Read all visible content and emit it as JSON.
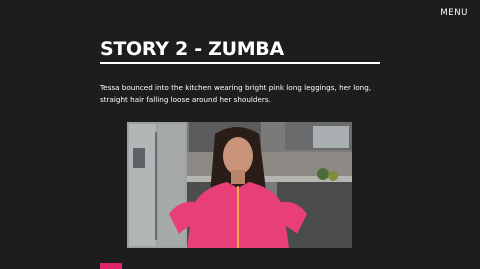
{
  "nav": {
    "menu_label": "MENU"
  },
  "story": {
    "title": "STORY 2 - ZUMBA",
    "paragraph": "Tessa bounced into the kitchen wearing bright pink long leggings, her long, straight hair falling loose around her shoulders."
  },
  "colors": {
    "background": "#1e1d1e",
    "text": "#ffffff",
    "accent_pink": "#e0246a"
  }
}
